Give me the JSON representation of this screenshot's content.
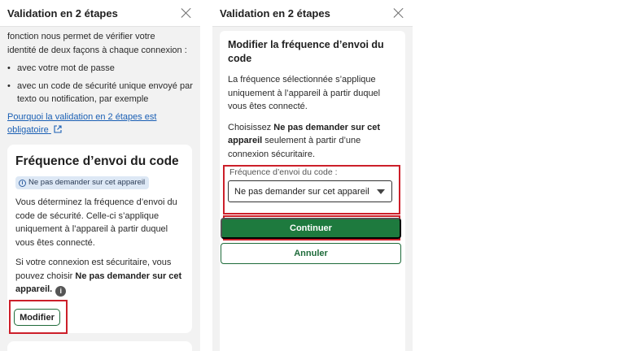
{
  "left": {
    "header": {
      "title": "Validation en 2 étapes"
    },
    "intro": {
      "line1": "fonction nous permet de vérifier votre",
      "line2": "identité de deux façons à chaque connexion :",
      "bullets": [
        "avec votre mot de passe",
        "avec un code de sécurité unique envoyé par texto ou notification, par exemple"
      ],
      "link": "Pourquoi la validation en 2 étapes est obligatoire"
    },
    "card": {
      "title": "Fréquence d’envoi du code",
      "badge": "Ne pas demander sur cet appareil",
      "paragraph1": "Vous déterminez la fréquence d’envoi du code de sécurité. Celle-ci s’applique uniquement à l’appareil à partir duquel vous êtes connecté.",
      "paragraph2_prefix": "Si votre connexion est sécuritaire, vous pouvez choisir ",
      "paragraph2_bold": "Ne pas demander sur cet appareil.",
      "modify_label": "Modifier"
    }
  },
  "right": {
    "header": {
      "title": "Validation en 2 étapes"
    },
    "modal": {
      "title": "Modifier la fréquence d’envoi du code",
      "paragraph1": "La fréquence sélectionnée s’applique uniquement à l’appareil à partir duquel vous êtes connecté.",
      "paragraph2_prefix": "Choisissez ",
      "paragraph2_bold": "Ne pas demander sur cet appareil",
      "paragraph2_suffix": " seulement à partir d’une connexion sécuritaire.",
      "select_label": "Fréquence d’envoi du code :",
      "select_value": "Ne pas demander sur cet appareil",
      "continue_label": "Continuer",
      "cancel_label": "Annuler"
    }
  },
  "colors": {
    "accent_green": "#1e7a3e",
    "highlight_red": "#cc1f2a",
    "link_blue": "#1a5fb4",
    "badge_bg": "#dde8f5"
  }
}
